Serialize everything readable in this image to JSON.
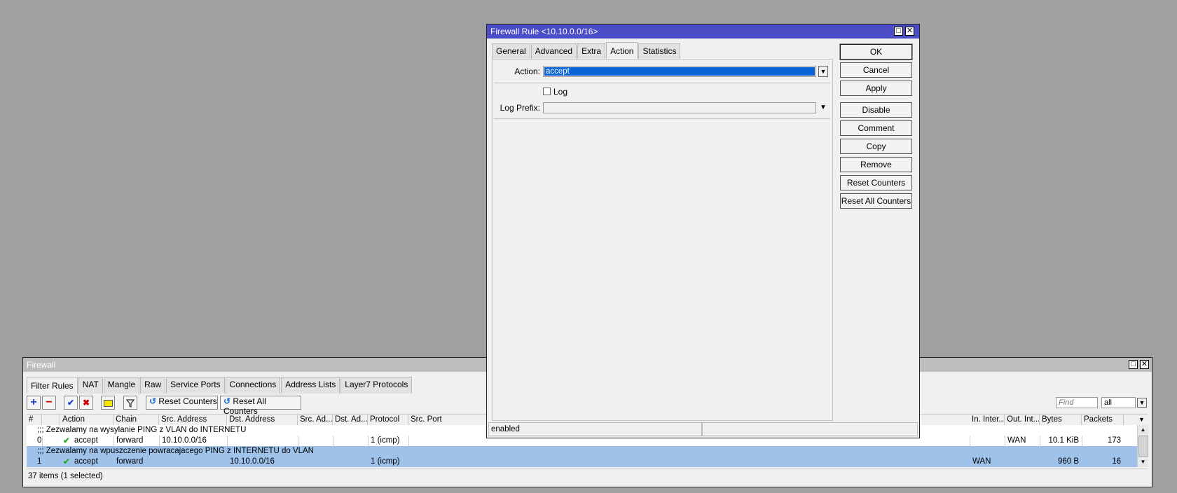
{
  "firewall": {
    "title": "Firewall",
    "tabs": [
      "Filter Rules",
      "NAT",
      "Mangle",
      "Raw",
      "Service Ports",
      "Connections",
      "Address Lists",
      "Layer7 Protocols"
    ],
    "toolbar": {
      "add_icon": "plus-icon",
      "remove_icon": "minus-icon",
      "enable_icon": "check-icon",
      "disable_icon": "x-icon",
      "comment_icon": "note-icon",
      "filter_icon": "funnel-icon",
      "reset_counters": "Reset Counters",
      "reset_all_counters": "Reset All Counters",
      "find_placeholder": "Find",
      "filter_value": "all"
    },
    "columns": {
      "num": "#",
      "action": "Action",
      "chain": "Chain",
      "src": "Src. Address",
      "dst": "Dst. Address",
      "src_ad": "Src. Ad...",
      "dst_ad": "Dst. Ad...",
      "protocol": "Protocol",
      "src_port": "Src. Port",
      "in_iface": "In. Inter...",
      "out_iface": "Out. Int...",
      "bytes": "Bytes",
      "packets": "Packets"
    },
    "rows": [
      {
        "comment": ";;; Zezwalamy na wysylanie PING z VLAN do INTERNETU",
        "num": "0",
        "action": "accept",
        "chain": "forward",
        "src": "10.10.0.0/16",
        "dst": "",
        "protocol": "1 (icmp)",
        "in_iface": "",
        "out_iface": "WAN",
        "bytes": "10.1 KiB",
        "packets": "173",
        "selected": false
      },
      {
        "comment": ";;; Zezwalamy na wpuszczenie powracajacego PING z INTERNETU do VLAN",
        "num": "1",
        "action": "accept",
        "chain": "forward",
        "src": "",
        "dst": "10.10.0.0/16",
        "protocol": "1 (icmp)",
        "in_iface": "WAN",
        "out_iface": "",
        "bytes": "960 B",
        "packets": "16",
        "selected": true
      }
    ],
    "status": "37 items (1 selected)"
  },
  "dialog": {
    "title": "Firewall Rule <10.10.0.0/16>",
    "tabs": [
      "General",
      "Advanced",
      "Extra",
      "Action",
      "Statistics"
    ],
    "active_tab": "Action",
    "action_label": "Action:",
    "action_value": "accept",
    "log_label": "Log",
    "log_checked": false,
    "log_prefix_label": "Log Prefix:",
    "log_prefix_value": "",
    "buttons": {
      "ok": "OK",
      "cancel": "Cancel",
      "apply": "Apply",
      "disable": "Disable",
      "comment": "Comment",
      "copy": "Copy",
      "remove": "Remove",
      "reset_counters": "Reset Counters",
      "reset_all_counters": "Reset All Counters"
    },
    "status": "enabled"
  },
  "colors": {
    "desktop": "#a0a0a0",
    "dialog_title": "#4a4dc6",
    "selection": "#9ec2ea",
    "action_selected": "#0a64d6",
    "accept_check": "#22aa22"
  }
}
